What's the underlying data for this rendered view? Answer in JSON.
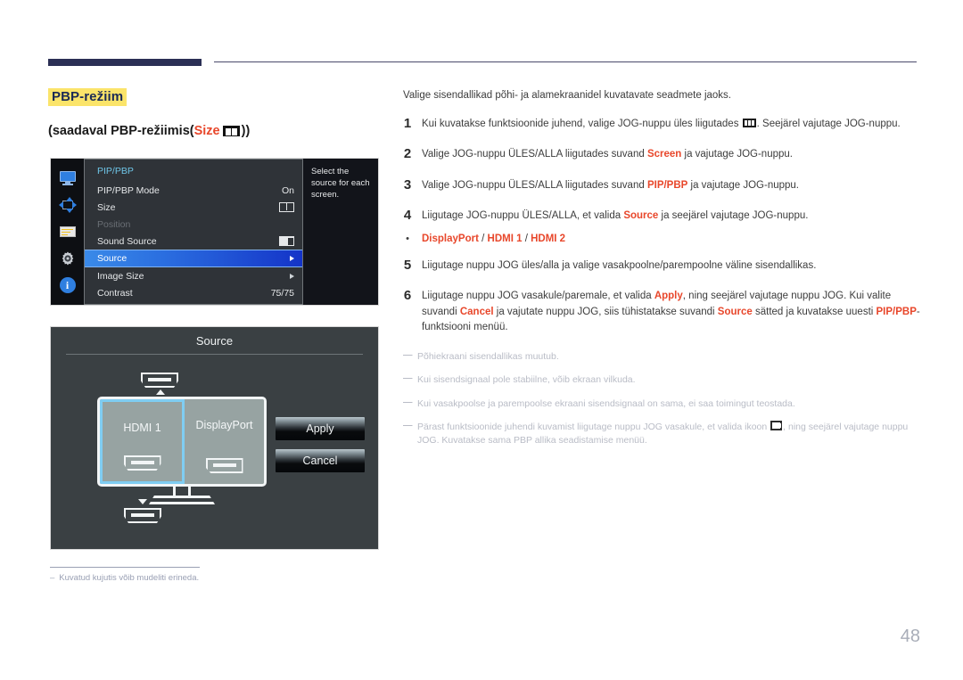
{
  "header": {
    "rule_color": "#2b2f55"
  },
  "left": {
    "section_title": "PBP-režiim",
    "subtitle_prefix": "(saadaval PBP-režiimis(",
    "subtitle_accent": "Size",
    "subtitle_suffix": "))",
    "size_icon": "pbp-two-pane-icon"
  },
  "osd": {
    "rail_icons": [
      "monitor-icon",
      "pip-pbp-position-icon",
      "on-screen-display-icon",
      "gear-icon",
      "info-icon"
    ],
    "category": "PIP/PBP",
    "rows": [
      {
        "label": "PIP/PBP Mode",
        "value": "On",
        "value_type": "text",
        "state": "normal"
      },
      {
        "label": "Size",
        "value": "",
        "value_type": "size-icon",
        "state": "normal"
      },
      {
        "label": "Position",
        "value": "",
        "value_type": "none",
        "state": "disabled"
      },
      {
        "label": "Sound Source",
        "value": "",
        "value_type": "sound-icon",
        "state": "normal"
      },
      {
        "label": "Source",
        "value": "",
        "value_type": "arrow",
        "state": "selected"
      },
      {
        "label": "Image Size",
        "value": "",
        "value_type": "arrow",
        "state": "normal"
      },
      {
        "label": "Contrast",
        "value": "75/75",
        "value_type": "text",
        "state": "normal"
      }
    ],
    "help_text": "Select the source for each screen.",
    "highlight_color": "#2b6fe0",
    "category_color": "#6fc6e8"
  },
  "source_dialog": {
    "title": "Source",
    "top_connector": "hdmi-connector-icon",
    "panes": [
      {
        "label": "HDMI 1",
        "connector": "hdmi-connector-icon",
        "selected": true
      },
      {
        "label": "DisplayPort",
        "connector": "displayport-connector-icon",
        "selected": false
      }
    ],
    "buttons": [
      {
        "label": "Apply",
        "name": "apply-button"
      },
      {
        "label": "Cancel",
        "name": "cancel-button"
      }
    ],
    "bottom_connector": "hdmi-connector-icon",
    "selection_color": "#7fcdf2"
  },
  "left_note": {
    "dash": "–",
    "text": "Kuvatud kujutis võib mudeliti erineda."
  },
  "right": {
    "lede": "Valige sisendallikad põhi- ja alamekraanidel kuvatavate seadmete jaoks.",
    "steps": [
      {
        "n": "1",
        "parts": [
          {
            "t": "Kui kuvatakse funktsioonide juhend, valige JOG-nuppu üles liigutades ",
            "k": "plain"
          },
          {
            "t": "menu-icon",
            "k": "glyph-menu"
          },
          {
            "t": ". Seejärel vajutage JOG-nuppu.",
            "k": "plain"
          }
        ]
      },
      {
        "n": "2",
        "parts": [
          {
            "t": "Valige JOG-nuppu ÜLES/ALLA liigutades suvand ",
            "k": "plain"
          },
          {
            "t": "Screen",
            "k": "accent"
          },
          {
            "t": " ja vajutage JOG-nuppu.",
            "k": "plain"
          }
        ]
      },
      {
        "n": "3",
        "parts": [
          {
            "t": "Valige JOG-nuppu ÜLES/ALLA liigutades suvand ",
            "k": "plain"
          },
          {
            "t": "PIP/PBP",
            "k": "accent"
          },
          {
            "t": " ja vajutage JOG-nuppu.",
            "k": "plain"
          }
        ]
      },
      {
        "n": "4",
        "parts": [
          {
            "t": "Liigutage JOG-nuppu ÜLES/ALLA, et valida ",
            "k": "plain"
          },
          {
            "t": "Source",
            "k": "accent"
          },
          {
            "t": " ja seejärel vajutage JOG-nuppu.",
            "k": "plain"
          }
        ]
      }
    ],
    "bullet": {
      "dot": "•",
      "parts": [
        {
          "t": "DisplayPort",
          "k": "accent"
        },
        {
          "t": " / ",
          "k": "plain"
        },
        {
          "t": "HDMI 1",
          "k": "accent"
        },
        {
          "t": " / ",
          "k": "plain"
        },
        {
          "t": "HDMI 2",
          "k": "accent"
        }
      ]
    },
    "steps2": [
      {
        "n": "5",
        "parts": [
          {
            "t": "Liigutage nuppu JOG üles/alla ja valige vasakpoolne/parempoolne väline sisendallikas.",
            "k": "plain"
          }
        ]
      },
      {
        "n": "6",
        "parts": [
          {
            "t": "Liigutage nuppu JOG vasakule/paremale, et valida ",
            "k": "plain"
          },
          {
            "t": "Apply",
            "k": "accent"
          },
          {
            "t": ", ning seejärel vajutage nuppu JOG. Kui valite suvandi ",
            "k": "plain"
          },
          {
            "t": "Cancel",
            "k": "accent"
          },
          {
            "t": " ja vajutate nuppu JOG, siis tühistatakse suvandi ",
            "k": "plain"
          },
          {
            "t": "Source",
            "k": "accent"
          },
          {
            "t": " sätted ja kuvatakse uuesti ",
            "k": "plain"
          },
          {
            "t": "PIP/PBP",
            "k": "accent"
          },
          {
            "t": "-funktsiooni menüü.",
            "k": "plain"
          }
        ]
      }
    ],
    "notes": [
      {
        "dash": "―",
        "parts": [
          {
            "t": "Põhiekraani sisendallikas muutub.",
            "k": "plain"
          }
        ]
      },
      {
        "dash": "―",
        "parts": [
          {
            "t": "Kui sisendsignaal pole stabiilne, võib ekraan vilkuda.",
            "k": "plain"
          }
        ]
      },
      {
        "dash": "―",
        "parts": [
          {
            "t": "Kui vasakpoolse ja parempoolse ekraani sisendsignaal on sama, ei saa toimingut teostada.",
            "k": "plain"
          }
        ]
      },
      {
        "dash": "―",
        "parts": [
          {
            "t": "Pärast funktsioonide juhendi kuvamist liigutage nuppu JOG vasakule, et valida ikoon ",
            "k": "plain"
          },
          {
            "t": "pbp-swap-icon",
            "k": "glyph-swap"
          },
          {
            "t": ", ning seejärel vajutage nuppu JOG. Kuvatakse sama PBP allika seadistamise menüü.",
            "k": "plain"
          }
        ]
      }
    ]
  },
  "page_number": "48",
  "colors": {
    "accent_red": "#e8472b",
    "highlight_yellow": "#fbe46a",
    "navy": "#2b2f55",
    "note_gray": "#b9bcc6"
  }
}
